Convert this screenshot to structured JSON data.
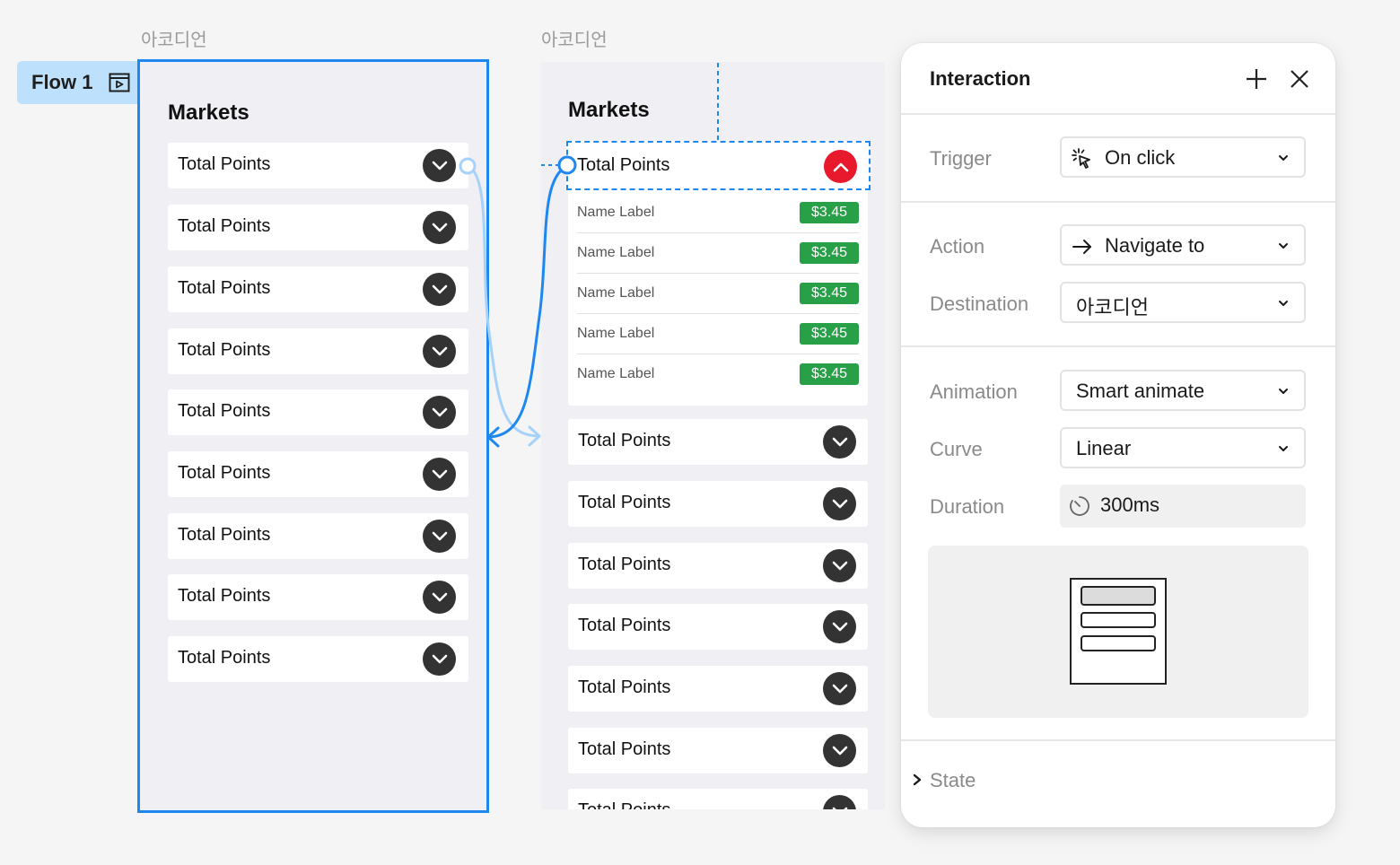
{
  "canvas": {
    "frame_a_label": "아코디언",
    "frame_b_label": "아코디언",
    "flow_label": "Flow 1"
  },
  "frame_a": {
    "title": "Markets",
    "rows": [
      "Total Points",
      "Total Points",
      "Total Points",
      "Total Points",
      "Total Points",
      "Total Points",
      "Total Points",
      "Total Points",
      "Total Points"
    ]
  },
  "frame_b": {
    "title": "Markets",
    "expanded_row": "Total Points",
    "sub_items": [
      {
        "name": "Name Label",
        "price": "$3.45"
      },
      {
        "name": "Name Label",
        "price": "$3.45"
      },
      {
        "name": "Name Label",
        "price": "$3.45"
      },
      {
        "name": "Name Label",
        "price": "$3.45"
      },
      {
        "name": "Name Label",
        "price": "$3.45"
      }
    ],
    "rows": [
      "Total Points",
      "Total Points",
      "Total Points",
      "Total Points",
      "Total Points",
      "Total Points",
      "Total Points"
    ]
  },
  "panel": {
    "title": "Interaction",
    "trigger_label": "Trigger",
    "trigger_value": "On click",
    "action_label": "Action",
    "action_value": "Navigate to",
    "destination_label": "Destination",
    "destination_value": "아코디언",
    "animation_label": "Animation",
    "animation_value": "Smart animate",
    "curve_label": "Curve",
    "curve_value": "Linear",
    "duration_label": "Duration",
    "duration_value": "300ms",
    "state_label": "State"
  },
  "colors": {
    "selection_blue": "#1e88f0",
    "chevron_dark": "#333333",
    "chevron_active_red": "#e8192c",
    "price_green": "#27a048",
    "flow_tag_bg": "#bde0fc"
  }
}
